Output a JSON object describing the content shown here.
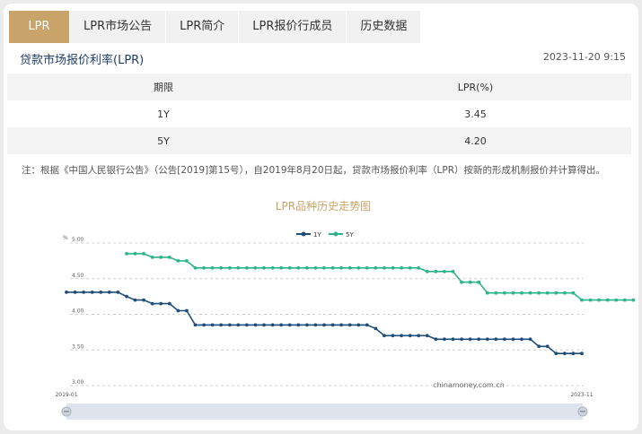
{
  "tabs": [
    "LPR",
    "LPR市场公告",
    "LPR简介",
    "LPR报价行成员",
    "历史数据"
  ],
  "header": {
    "title": "贷款市场报价利率(LPR)",
    "date": "2023-11-20 9:15"
  },
  "table": {
    "headers": [
      "期限",
      "LPR(%)"
    ],
    "rows": [
      [
        "1Y",
        "3.45"
      ],
      [
        "5Y",
        "4.20"
      ]
    ]
  },
  "note": "注：根据《中国人民银行公告》（公告[2019]第15号），自2019年8月20日起，贷款市场报价利率（LPR）按新的形成机制报价并计算得出。",
  "colors": {
    "accent": "#c9a46a",
    "line_1y": "#1f4e79",
    "line_5y": "#2bb58a",
    "title": "#1f3d6b"
  },
  "chart_data": {
    "type": "line",
    "title": "LPR品种历史走势图",
    "ylabel": "%",
    "ylim": [
      3.0,
      5.0
    ],
    "yticks": [
      "5.00",
      "4.50",
      "4.00",
      "3.50",
      "3.00"
    ],
    "x_labels": [
      "2019-01",
      "2023-11"
    ],
    "legend": "top-center",
    "watermark": "chinamoney.com.cn",
    "series": [
      {
        "name": "1Y",
        "values": [
          4.31,
          4.31,
          4.31,
          4.31,
          4.31,
          4.31,
          4.31,
          4.25,
          4.2,
          4.2,
          4.15,
          4.15,
          4.15,
          4.05,
          4.05,
          3.85,
          3.85,
          3.85,
          3.85,
          3.85,
          3.85,
          3.85,
          3.85,
          3.85,
          3.85,
          3.85,
          3.85,
          3.85,
          3.85,
          3.85,
          3.85,
          3.85,
          3.85,
          3.85,
          3.85,
          3.85,
          3.8,
          3.7,
          3.7,
          3.7,
          3.7,
          3.7,
          3.7,
          3.65,
          3.65,
          3.65,
          3.65,
          3.65,
          3.65,
          3.65,
          3.65,
          3.65,
          3.65,
          3.65,
          3.65,
          3.55,
          3.55,
          3.45,
          3.45,
          3.45,
          3.45
        ]
      },
      {
        "name": "5Y",
        "values": [
          4.85,
          4.85,
          4.85,
          4.8,
          4.8,
          4.8,
          4.75,
          4.75,
          4.65,
          4.65,
          4.65,
          4.65,
          4.65,
          4.65,
          4.65,
          4.65,
          4.65,
          4.65,
          4.65,
          4.65,
          4.65,
          4.65,
          4.65,
          4.65,
          4.65,
          4.65,
          4.65,
          4.65,
          4.65,
          4.65,
          4.65,
          4.65,
          4.65,
          4.65,
          4.65,
          4.6,
          4.6,
          4.6,
          4.6,
          4.45,
          4.45,
          4.45,
          4.3,
          4.3,
          4.3,
          4.3,
          4.3,
          4.3,
          4.3,
          4.3,
          4.3,
          4.3,
          4.3,
          4.2,
          4.2,
          4.2,
          4.2,
          4.2,
          4.2,
          4.2
        ]
      }
    ]
  }
}
